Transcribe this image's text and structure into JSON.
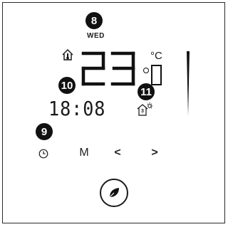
{
  "callouts": {
    "c8": "8",
    "c9": "9",
    "c10": "10",
    "c11": "11"
  },
  "display": {
    "day": "WED",
    "temperature": "23",
    "temperature_unit": "°C",
    "decimal": "0",
    "time": "18:08",
    "comfort_level": "3"
  },
  "controls": {
    "mode_label": "M",
    "prev_symbol": "<",
    "next_symbol": ">"
  },
  "icons": {
    "home": "home-thermometer-icon",
    "clock": "clock-icon",
    "eco": "leaf-icon",
    "comfort": "house-sun-icon"
  },
  "colors": {
    "segment": "#111111",
    "callout_bg": "#111111"
  }
}
